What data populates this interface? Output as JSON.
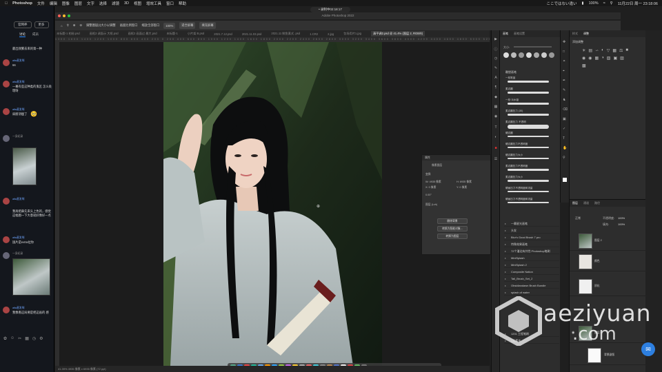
{
  "menubar": {
    "app": "Photoshop",
    "items": [
      "文件",
      "编辑",
      "图像",
      "图层",
      "文字",
      "选择",
      "滤镜",
      "3D",
      "视图",
      "增效工具",
      "窗口",
      "帮助"
    ],
    "status": "ここではない違い",
    "battery": "100%",
    "datetime": "11月22日 周一 23:18:06"
  },
  "recording": "• 录制中02:18:17",
  "window_title": "Adobe Photoshop 2022",
  "chat": {
    "buttons": [
      "官网养",
      "更多"
    ],
    "tabs": [
      "讨论",
      "成员"
    ],
    "messages": [
      {
        "name": "",
        "text": "最出频繁去来的第一种"
      },
      {
        "name": "aita麦发咪",
        "text": "66"
      },
      {
        "name": "aita麦发咪",
        "text": "一幕有些这种类的鬼区 怎么处理呀"
      },
      {
        "name": "aita麦发咪",
        "text": "肩膀消瘦了"
      },
      {
        "name": "一身纪录",
        "text": ""
      },
      {
        "name": "aita麦发咪",
        "text": "我再把鼻先来头上色的，感觉这幅图一下大意就好像好一点"
      },
      {
        "name": "aita麦发咪",
        "text": "国片是extra拉你"
      },
      {
        "name": "一身纪录",
        "text": ""
      },
      {
        "name": "aita麦发咪",
        "text": "我像看这局要是把这画的 感"
      }
    ],
    "emoji": "🥺"
  },
  "options_bar": {
    "items": [
      "调整图层(I)大小以调整",
      "画面比例窗口",
      "缩放全部窗口",
      "100%",
      "适合屏幕",
      "填充屏幕"
    ]
  },
  "tabs": [
    "未标题-1 柏秘.psd",
    "画框2 调面示 大框.psd",
    "画框2 画面过 最大.psd",
    "未标题-1",
    "小片架 B.psd",
    "2021.7.12.psd",
    "2021.11.03.psd",
    "2021.11 鲸鱼素式 .psd",
    "1.CR2",
    "2.jpg",
    "包场用片1.jpg",
    "清平调2.psd @ 41.4% (图层 2, RGB/8)"
  ],
  "active_tab_index": 11,
  "ruler_text": "1300 1600 1400 1200 1000 800 600 400 200 0 200 400 600 800 1000 1200 1400 1600 1800 2000 2200 2400 2600 2800 3000 3200 3400 3600 3800 4000 4200 4400 4600 4800 5000 5200",
  "status_bar": "41.39%   4935 像素 x 6935 像素 (72 ppi)",
  "properties": {
    "title": "属性",
    "subtitle": "像素图层",
    "rows": [
      "变换",
      "W: 4935 像素",
      "H: 6935 像素",
      "X: 0 像素",
      "Y: 0 像素",
      "0.00°",
      "图层 (Lch)"
    ],
    "buttons": [
      "删除背景",
      "转换为智能对象...",
      "转换为图层"
    ]
  },
  "brushes": {
    "tabs": [
      "画笔",
      "画笔设置"
    ],
    "size_label": "大小:",
    "size": "",
    "groups": [
      {
        "label": "雕塑画笔"
      },
      {
        "label": "一枝笔蓝"
      },
      {
        "label": "柔边圆"
      },
      {
        "label": "一枝·淡水蓝"
      },
      {
        "label": "柔边圆压力 (30)"
      },
      {
        "label": "柔边圆压力 不透明"
      },
      {
        "label": "硬边圆"
      },
      {
        "label": "硬边圆压力不透明度"
      },
      {
        "label": "硬边圆压力大小"
      },
      {
        "label": "柔边圆压力不透明度"
      },
      {
        "label": "柔边圆压力大小"
      },
      {
        "label": "硬画压力不透明度和流量"
      },
      {
        "label": "硬画压力不透明度和流量"
      }
    ],
    "folders": [
      "一幕星光画笔",
      "头发",
      "Blur's Good Brush 7 pro",
      "特殊效果画笔",
      "72个潘达有共性 Photoshop笔刷",
      "MiniSplash",
      "MiniSplash 2",
      "Composite Nation",
      "Tall_Brush_Set_2",
      "Obsidiandawn Brush Bundle",
      "splash of water",
      "",
      "",
      "",
      "",
      "",
      "",
      "",
      "1201 工程笔刷",
      "1元素体"
    ]
  },
  "adjustments": {
    "tabs": [
      "样式",
      "调整"
    ],
    "title": "添加调整"
  },
  "layers": {
    "tabs": [
      "图层",
      "通道",
      "路径"
    ],
    "blend": "正常",
    "opacity_label": "不透明度:",
    "opacity": "100%",
    "fill_label": "填充:",
    "fill": "100%",
    "items": [
      {
        "name": "图层 2"
      },
      {
        "name": "颜色"
      },
      {
        "name": "质化"
      },
      {
        "name": "图层 1"
      },
      {
        "name": "背景副版"
      }
    ]
  },
  "watermark": {
    "line1": "aeziyuan",
    "line2": ".com"
  },
  "colors": {
    "accent": "#2d8cff",
    "chat_bg": "#14171d",
    "panel_bg": "#2d2d2d"
  }
}
